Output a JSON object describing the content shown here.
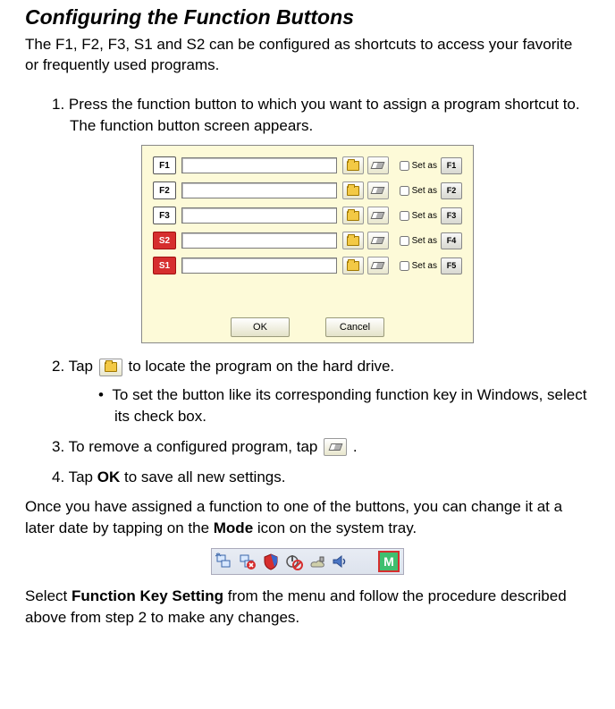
{
  "heading": "Configuring the Function Buttons",
  "intro": "The F1, F2, F3, S1 and S2 can be configured as shortcuts to access your favorite or frequently used programs.",
  "steps": {
    "s1": "1. Press the function button to which you want to assign a program shortcut to. The function button screen appears.",
    "s2_pre": "2. Tap ",
    "s2_post": " to locate the program on the hard drive.",
    "s2_bullet": "To set the button like its corresponding function key in Windows, select its check box.",
    "s3_pre": "3. To remove a configured program, tap ",
    "s3_post": ".",
    "s4_pre": "4. Tap ",
    "s4_ok": "OK",
    "s4_post": " to save all new settings."
  },
  "outro1_pre": "Once you have assigned a function to one of the buttons, you can change it at a later date by tapping on the ",
  "outro1_mode": "Mode",
  "outro1_post": " icon on the system tray.",
  "outro2_pre": "Select ",
  "outro2_bold": "Function Key Setting",
  "outro2_post": " from the menu and follow the procedure described above from step 2 to make any changes.",
  "dialog": {
    "ok": "OK",
    "cancel": "Cancel",
    "setas": "Set as",
    "rows": [
      {
        "left": "F1",
        "left_red": false,
        "key": "F1"
      },
      {
        "left": "F2",
        "left_red": false,
        "key": "F2"
      },
      {
        "left": "F3",
        "left_red": false,
        "key": "F3"
      },
      {
        "left": "S2",
        "left_red": true,
        "key": "F4"
      },
      {
        "left": "S1",
        "left_red": true,
        "key": "F5"
      }
    ]
  },
  "tray": {
    "mode_letter": "M"
  }
}
